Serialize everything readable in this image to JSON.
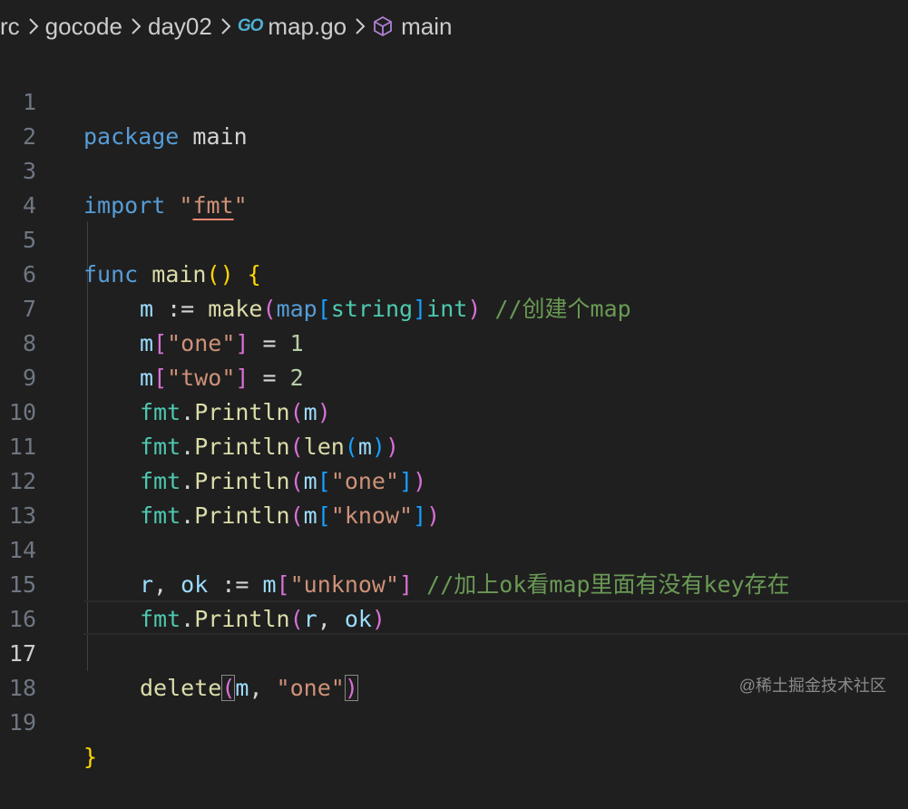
{
  "breadcrumb": {
    "items": [
      "rc",
      "gocode",
      "day02",
      "map.go",
      "main"
    ],
    "go_logo": "GO",
    "icons": [
      "chevron-right-icon",
      "go-file-icon",
      "symbol-method-cube-icon"
    ]
  },
  "editor": {
    "active_line": "17",
    "lines": [
      {
        "n": "1",
        "t": [
          "package",
          " ",
          "main"
        ]
      },
      {
        "n": "2",
        "t": []
      },
      {
        "n": "3",
        "t": [
          "import",
          " ",
          "\"",
          "fmt",
          "\""
        ]
      },
      {
        "n": "4",
        "t": []
      },
      {
        "n": "5",
        "t": [
          "func",
          " ",
          "main",
          "(",
          ")",
          " ",
          "{"
        ]
      },
      {
        "n": "6",
        "t": [
          "m",
          " := ",
          "make",
          "(",
          "map",
          "[",
          "string",
          "]",
          "int",
          ")",
          " ",
          "//创建个map"
        ]
      },
      {
        "n": "7",
        "t": [
          "m",
          "[",
          "\"one\"",
          "]",
          " = ",
          "1"
        ]
      },
      {
        "n": "8",
        "t": [
          "m",
          "[",
          "\"two\"",
          "]",
          " = ",
          "2"
        ]
      },
      {
        "n": "9",
        "t": [
          "fmt",
          ".",
          "Println",
          "(",
          "m",
          ")"
        ]
      },
      {
        "n": "10",
        "t": [
          "fmt",
          ".",
          "Println",
          "(",
          "len",
          "(",
          "m",
          ")",
          ")"
        ]
      },
      {
        "n": "11",
        "t": [
          "fmt",
          ".",
          "Println",
          "(",
          "m",
          "[",
          "\"one\"",
          "]",
          ")"
        ]
      },
      {
        "n": "12",
        "t": [
          "fmt",
          ".",
          "Println",
          "(",
          "m",
          "[",
          "\"know\"",
          "]",
          ")"
        ]
      },
      {
        "n": "13",
        "t": []
      },
      {
        "n": "14",
        "t": [
          "r",
          ", ",
          "ok",
          " := ",
          "m",
          "[",
          "\"unknow\"",
          "]",
          " ",
          "//加上ok看map里面有没有key存在"
        ]
      },
      {
        "n": "15",
        "t": [
          "fmt",
          ".",
          "Println",
          "(",
          "r",
          ", ",
          "ok",
          ")"
        ]
      },
      {
        "n": "16",
        "t": []
      },
      {
        "n": "17",
        "t": [
          "delete",
          "(",
          "m",
          ", ",
          "\"one\"",
          ")"
        ]
      },
      {
        "n": "18",
        "t": []
      },
      {
        "n": "19",
        "t": [
          "}"
        ]
      }
    ]
  },
  "watermark": "@稀土掘金技术社区",
  "colors": {
    "background": "#1f1f1f",
    "keyword": "#569cd6",
    "function": "#dcdcaa",
    "variable": "#9cdcfe",
    "type": "#4ec9b0",
    "string": "#ce9178",
    "number": "#b5cea8",
    "comment": "#6a9955",
    "bracket_level1": "#ffd700",
    "bracket_level2": "#da70d6",
    "bracket_level3": "#179fff"
  }
}
